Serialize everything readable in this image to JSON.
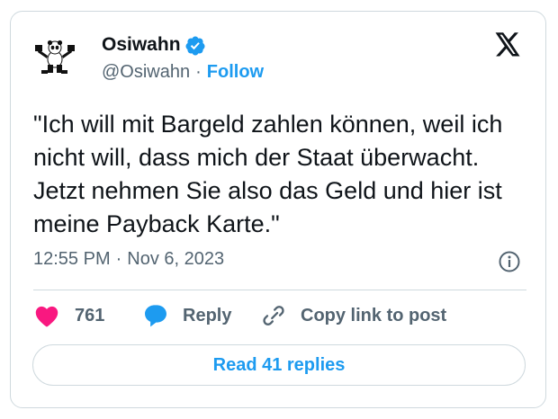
{
  "author": {
    "name": "Osiwahn",
    "handle": "@Osiwahn",
    "separator": "·",
    "follow_label": "Follow"
  },
  "tweet": {
    "text": "\"Ich will mit Bargeld zahlen können, weil ich nicht will, dass mich der Staat überwacht. Jetzt nehmen Sie also das Geld und hier ist meine Payback Karte.\"",
    "time": "12:55 PM",
    "separator": "·",
    "date": "Nov 6, 2023"
  },
  "actions": {
    "like_count": "761",
    "reply_label": "Reply",
    "copy_label": "Copy link to post"
  },
  "read_replies_label": "Read 41 replies",
  "colors": {
    "accent": "#1d9bf0",
    "like": "#f91880",
    "text": "#0f1419",
    "secondary": "#536471",
    "border": "#cfd9de"
  },
  "icons": [
    "panda-avatar",
    "verified-badge-icon",
    "x-logo-icon",
    "info-icon",
    "heart-icon",
    "reply-bubble-icon",
    "link-icon"
  ]
}
